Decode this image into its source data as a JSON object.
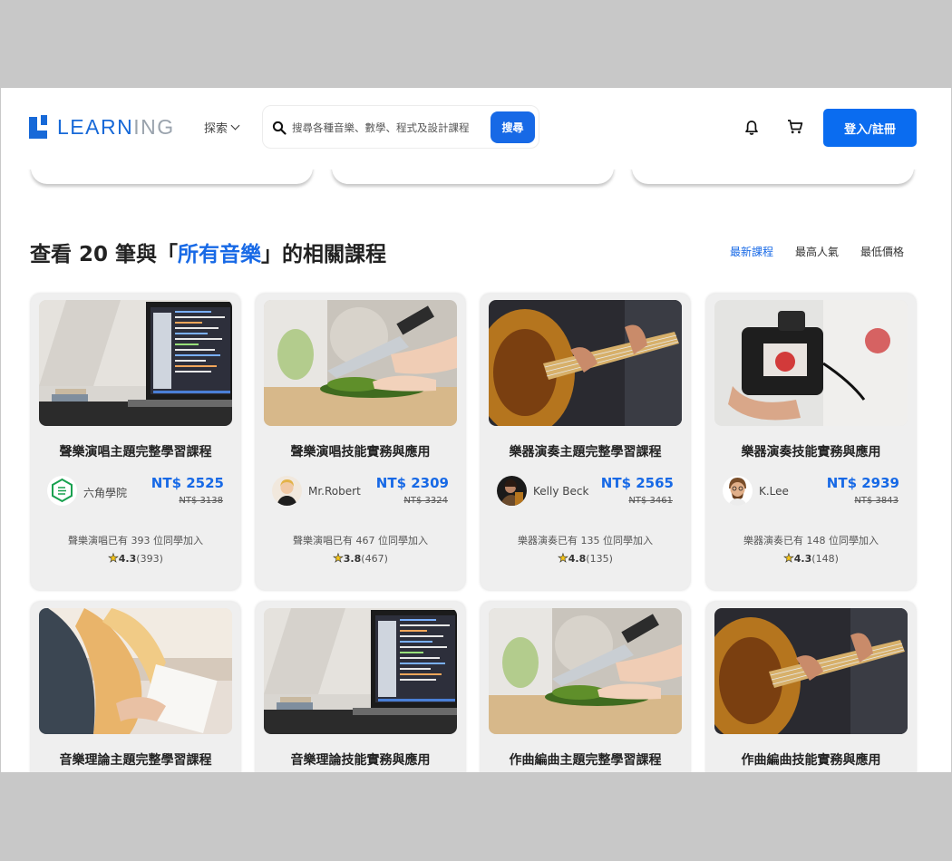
{
  "brand": {
    "logo_text_a": "LEARN",
    "logo_text_b": "ING"
  },
  "nav": {
    "explore_label": "探索"
  },
  "search": {
    "placeholder": "搜尋各種音樂、數學、程式及設計課程",
    "button_label": "搜尋"
  },
  "header_actions": {
    "login_label": "登入/註冊"
  },
  "section": {
    "heading_prefix": "查看 20 筆與「",
    "heading_highlight": "所有音樂",
    "heading_suffix": "」的相關課程",
    "sort_options": [
      "最新課程",
      "最高人氣",
      "最低價格"
    ],
    "active_sort": "最新課程"
  },
  "courses": [
    {
      "title": "聲樂演唱主題完整學習課程",
      "instructor": "六角學院",
      "price": "NT$ 2525",
      "original_price": "NT$ 3138",
      "joined": "聲樂演唱已有 393 位同學加入",
      "rating": "4.3",
      "rating_count": "(393)",
      "thumb": "laptop"
    },
    {
      "title": "聲樂演唱技能實務與應用",
      "instructor": "Mr.Robert",
      "price": "NT$ 2309",
      "original_price": "NT$ 3324",
      "joined": "聲樂演唱已有 467 位同學加入",
      "rating": "3.8",
      "rating_count": "(467)",
      "thumb": "cooking"
    },
    {
      "title": "樂器演奏主題完整學習課程",
      "instructor": "Kelly Beck",
      "price": "NT$ 2565",
      "original_price": "NT$ 3461",
      "joined": "樂器演奏已有 135 位同學加入",
      "rating": "4.8",
      "rating_count": "(135)",
      "thumb": "guitar"
    },
    {
      "title": "樂器演奏技能實務與應用",
      "instructor": "K.Lee",
      "price": "NT$ 2939",
      "original_price": "NT$ 3843",
      "joined": "樂器演奏已有 148 位同學加入",
      "rating": "4.3",
      "rating_count": "(148)",
      "thumb": "camera"
    },
    {
      "title": "音樂理論主題完整學習課程",
      "thumb": "writing"
    },
    {
      "title": "音樂理論技能實務與應用",
      "thumb": "laptop"
    },
    {
      "title": "作曲編曲主題完整學習課程",
      "thumb": "cooking"
    },
    {
      "title": "作曲編曲技能實務與應用",
      "thumb": "guitar"
    }
  ],
  "colors": {
    "primary": "#1769e6",
    "card_bg": "#efefef",
    "page_bg": "#c8c8c8"
  },
  "icons": [
    "search-icon",
    "chevron-down-icon",
    "bell-icon",
    "cart-icon",
    "star-icon"
  ]
}
